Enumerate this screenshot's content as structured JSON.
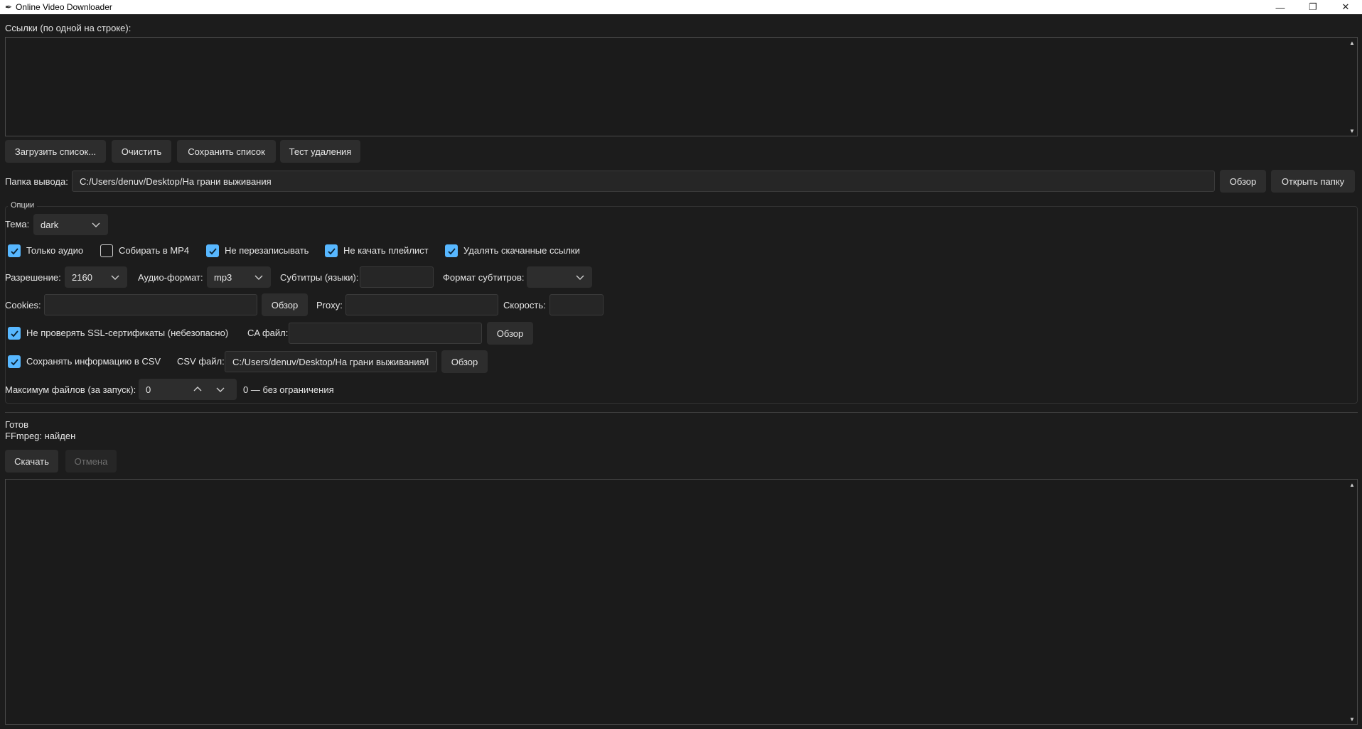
{
  "window": {
    "title": "Online Video Downloader",
    "minimize_glyph": "—",
    "maximize_glyph": "❐",
    "close_glyph": "✕"
  },
  "links": {
    "label": "Ссылки (по одной на строке):",
    "value": ""
  },
  "list_buttons": {
    "load": "Загрузить список...",
    "clear": "Очистить",
    "save": "Сохранить список",
    "test_delete": "Тест удаления"
  },
  "output": {
    "label": "Папка вывода:",
    "path": "C:/Users/denuv/Desktop/На грани выживания",
    "browse": "Обзор",
    "open_folder": "Открыть папку"
  },
  "options": {
    "title": "Опции",
    "theme_label": "Тема:",
    "theme_value": "dark",
    "checkboxes": [
      {
        "label": "Только аудио",
        "checked": true
      },
      {
        "label": "Собирать в MP4",
        "checked": false
      },
      {
        "label": "Не перезаписывать",
        "checked": true
      },
      {
        "label": "Не качать плейлист",
        "checked": true
      },
      {
        "label": "Удалять скачанные ссылки",
        "checked": true
      }
    ],
    "resolution_label": "Разрешение:",
    "resolution_value": "2160",
    "audio_format_label": "Аудио-формат:",
    "audio_format_value": "mp3",
    "subs_label": "Субтитры (языки):",
    "subs_value": "",
    "subs_format_label": "Формат субтитров:",
    "subs_format_value": "",
    "cookies_label": "Cookies:",
    "cookies_value": "",
    "cookies_browse": "Обзор",
    "proxy_label": "Proxy:",
    "proxy_value": "",
    "speed_label": "Скорость:",
    "speed_value": "",
    "ssl_label": "Не проверять SSL-сертификаты (небезопасно)",
    "ssl_checked": true,
    "ca_label": "CA файл:",
    "ca_value": "",
    "ca_browse": "Обзор",
    "csv_check_label": "Сохранять информацию в CSV",
    "csv_checked": true,
    "csv_label": "CSV файл:",
    "csv_value": "C:/Users/denuv/Desktop/На грани выживания/l",
    "csv_browse": "Обзор",
    "max_files_label": "Максимум файлов (за запуск):",
    "max_files_value": "0",
    "max_files_hint": "0 — без ограничения"
  },
  "status": {
    "state": "Готов",
    "ffmpeg": "FFmpeg: найден"
  },
  "actions": {
    "download": "Скачать",
    "cancel": "Отмена"
  },
  "log": {
    "value": ""
  },
  "colors": {
    "accent": "#57b7ff",
    "background": "#1c1c1c"
  }
}
